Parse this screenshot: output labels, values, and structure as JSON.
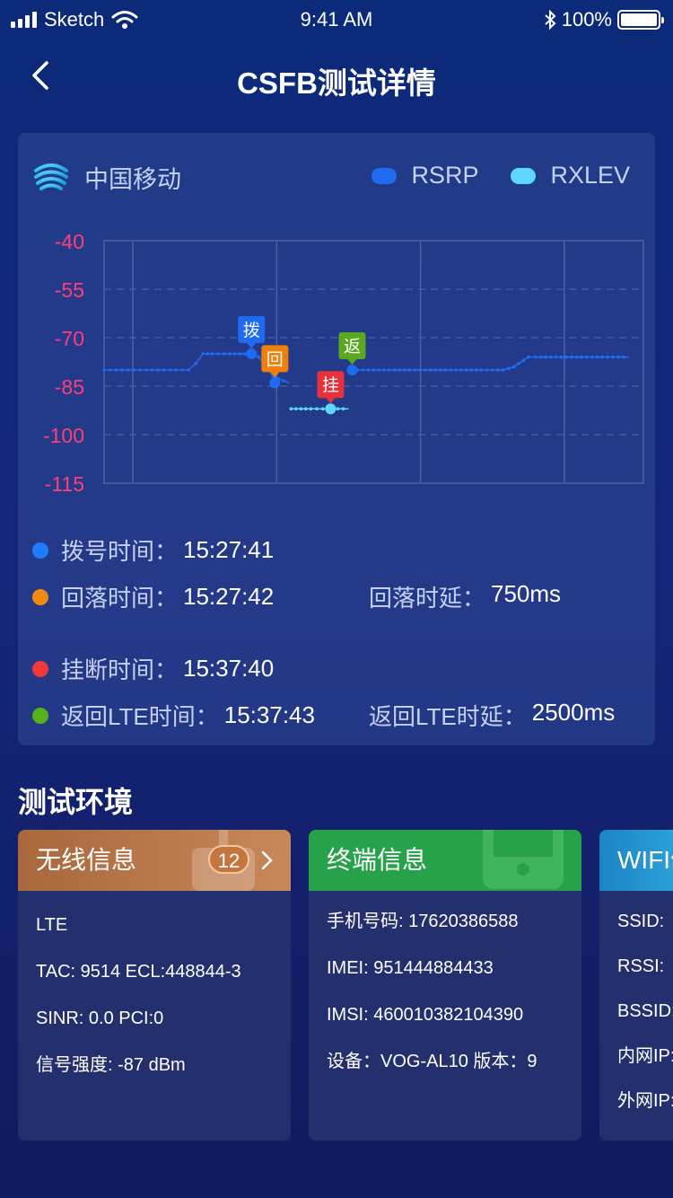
{
  "status_bar": {
    "carrier": "Sketch",
    "time": "9:41 AM",
    "battery": "100%"
  },
  "nav": {
    "title": "CSFB测试详情"
  },
  "chart_card": {
    "carrier_name": "中国移动",
    "legend": [
      {
        "label": "RSRP",
        "color": "#1f6bf0"
      },
      {
        "label": "RXLEV",
        "color": "#5fd8ff"
      }
    ]
  },
  "chart_data": {
    "type": "line",
    "ylim": [
      -115,
      -40
    ],
    "y_ticks": [
      "-40",
      "-55",
      "-70",
      "-85",
      "-100",
      "-115"
    ],
    "grid": true,
    "series": [
      {
        "name": "RSRP",
        "color": "#1f6bf0",
        "points": [
          [
            0,
            -80
          ],
          [
            10,
            -80
          ],
          [
            20,
            -80
          ],
          [
            30,
            -80
          ],
          [
            40,
            -80
          ],
          [
            47,
            -80
          ],
          [
            51,
            -78
          ],
          [
            55,
            -75
          ],
          [
            60,
            -75
          ],
          [
            70,
            -75
          ],
          [
            81,
            -75
          ],
          [
            86,
            -76
          ],
          [
            94,
            -82
          ],
          [
            103,
            -84
          ]
        ]
      },
      {
        "name": "RSRP",
        "color": "#1f6bf0",
        "points": [
          [
            138,
            -80
          ],
          [
            150,
            -80
          ],
          [
            170,
            -80
          ],
          [
            190,
            -80
          ],
          [
            210,
            -80
          ],
          [
            222,
            -80
          ],
          [
            228,
            -79
          ],
          [
            236,
            -76
          ],
          [
            240,
            -76
          ],
          [
            260,
            -76
          ],
          [
            280,
            -76
          ],
          [
            292,
            -76
          ]
        ]
      },
      {
        "name": "RXLEV",
        "color": "#5fd8ff",
        "points": [
          [
            104,
            -92
          ],
          [
            115,
            -92
          ],
          [
            125,
            -92
          ],
          [
            130,
            -92
          ],
          [
            136,
            -92
          ]
        ]
      }
    ],
    "markers": [
      {
        "label": "拨",
        "x": 82,
        "y": -75,
        "color": "#1f6bf0",
        "point_color": "#1f6bf0"
      },
      {
        "label": "回",
        "x": 95,
        "y": -84,
        "color": "#f0800a",
        "point_color": "#1f6bf0"
      },
      {
        "label": "挂",
        "x": 126,
        "y": -92,
        "color": "#e8303a",
        "point_color": "#5fd8ff"
      },
      {
        "label": "返",
        "x": 138,
        "y": -80,
        "color": "#5aa820",
        "point_color": "#1f6bf0"
      }
    ]
  },
  "events": {
    "dial": {
      "label": "拨号时间：",
      "value": "15:27:41",
      "color": "#1f7bff"
    },
    "fallback": {
      "label": "回落时间：",
      "value": "15:27:42",
      "color": "#f08a10"
    },
    "fallback_delay": {
      "label": "回落时延：",
      "value": "750ms"
    },
    "hangup": {
      "label": "挂断时间：",
      "value": "15:37:40",
      "color": "#f03a3a"
    },
    "return_lte": {
      "label": "返回LTE时间：",
      "value": "15:37:43",
      "color": "#55b21c"
    },
    "return_lte_delay": {
      "label": "返回LTE时延：",
      "value": "2500ms"
    }
  },
  "section": {
    "title": "测试环境"
  },
  "wireless": {
    "title": "无线信息",
    "badge": "12",
    "lines": [
      "LTE",
      "TAC:  9514  ECL:448844-3",
      "SINR:  0.0   PCI:0",
      "信号强度:  -87 dBm"
    ]
  },
  "terminal": {
    "title": "终端信息",
    "lines": [
      "手机号码: 17620386588",
      "IMEI: 951444884433",
      "IMSI: 460010382104390",
      "设备：VOG-AL10 版本：9"
    ]
  },
  "wifi": {
    "title": "WIFI信息",
    "lines": [
      "SSID:",
      "RSSI:",
      "BSSID:",
      "内网IP:",
      "外网IP:"
    ]
  }
}
